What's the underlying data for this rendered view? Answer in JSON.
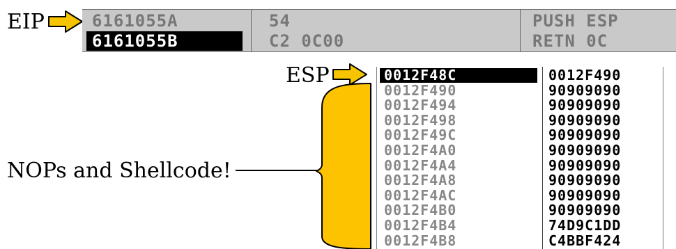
{
  "labels": {
    "eip": "EIP",
    "esp": "ESP",
    "annotation": "NOPs and Shellcode!"
  },
  "colors": {
    "arrow_fill": "#f7c500",
    "arrow_stroke": "#000000",
    "brace_fill": "#fdc300",
    "pane_bg": "#c9c9c9"
  },
  "disassembly": [
    {
      "address": "6161055A",
      "hex": "54",
      "instruction": "PUSH ESP",
      "selected": false
    },
    {
      "address": "6161055B",
      "hex": "C2 0C00",
      "instruction": "RETN 0C",
      "selected": true
    }
  ],
  "stack": [
    {
      "address": "0012F48C",
      "value": "0012F490"
    },
    {
      "address": "0012F490",
      "value": "90909090"
    },
    {
      "address": "0012F494",
      "value": "90909090"
    },
    {
      "address": "0012F498",
      "value": "90909090"
    },
    {
      "address": "0012F49C",
      "value": "90909090"
    },
    {
      "address": "0012F4A0",
      "value": "90909090"
    },
    {
      "address": "0012F4A4",
      "value": "90909090"
    },
    {
      "address": "0012F4A8",
      "value": "90909090"
    },
    {
      "address": "0012F4AC",
      "value": "90909090"
    },
    {
      "address": "0012F4B0",
      "value": "90909090"
    },
    {
      "address": "0012F4B4",
      "value": "74D9C1DD"
    },
    {
      "address": "0012F4B8",
      "value": "C4BBF424"
    }
  ]
}
